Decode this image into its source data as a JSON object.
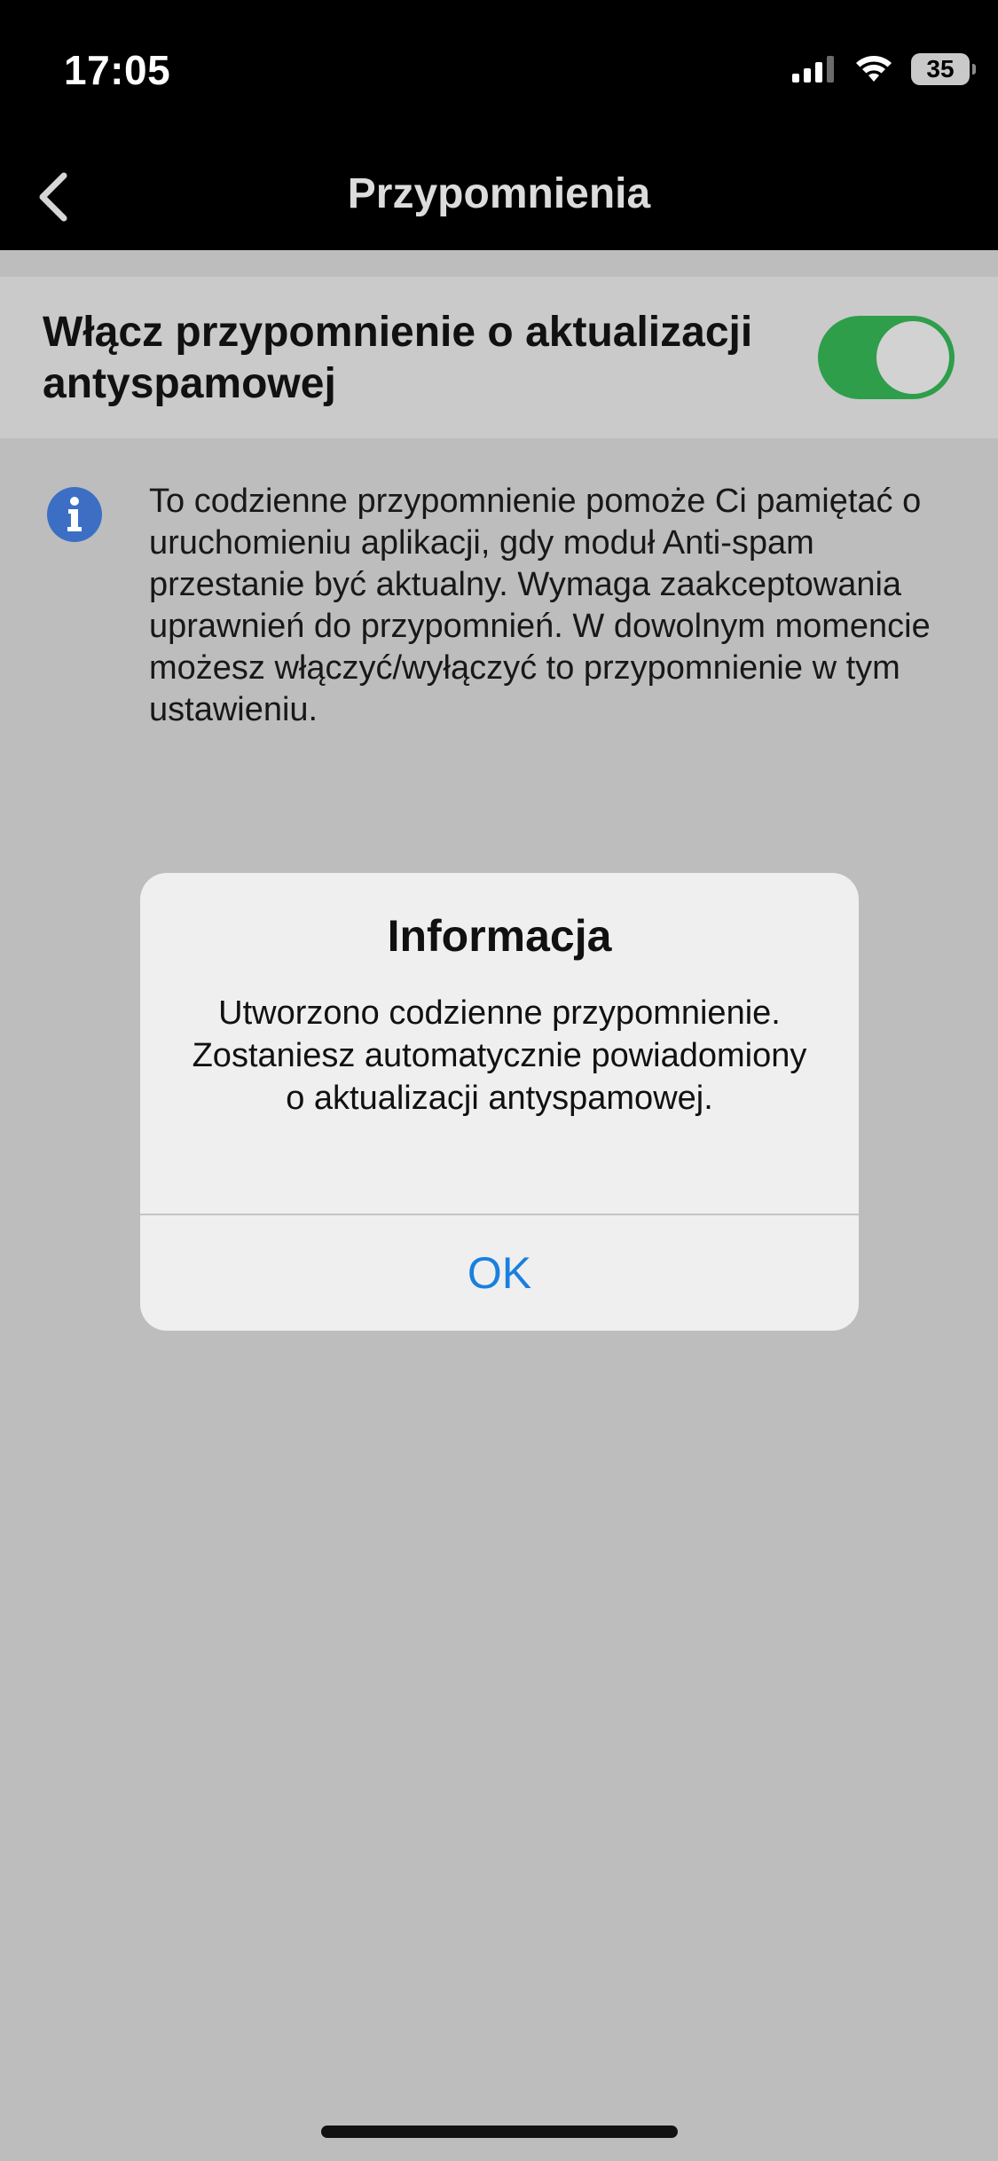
{
  "status_bar": {
    "time": "17:05",
    "battery_level": "35",
    "signal_bars": 3,
    "icons": [
      "cellular-signal-icon",
      "wifi-icon",
      "battery-icon"
    ]
  },
  "nav": {
    "back_icon": "chevron-left-icon",
    "title": "Przypomnienia"
  },
  "settings": {
    "reminder_toggle": {
      "label": "Włącz przypomnienie o aktualizacji antyspamowej",
      "is_on": true
    },
    "info": {
      "icon": "info-icon",
      "text": "To codzienne przypomnienie pomoże Ci pamiętać o uruchomieniu aplikacji, gdy moduł Anti-spam przestanie być aktualny. Wymaga zaakceptowania uprawnień do przypomnień. W dowolnym momencie możesz włączyć/wyłączyć to przypomnienie w tym ustawieniu."
    }
  },
  "alert": {
    "title": "Informacja",
    "message": "Utworzono codzienne przypomnienie. Zostaniesz automatycznie powiadomiony o aktualizacji antyspamowej.",
    "ok_label": "OK"
  },
  "colors": {
    "switch_on": "#2e9e4a",
    "alert_button": "#1a7fe0",
    "info_icon": "#3c6fc4",
    "background": "#bdbdbd"
  }
}
